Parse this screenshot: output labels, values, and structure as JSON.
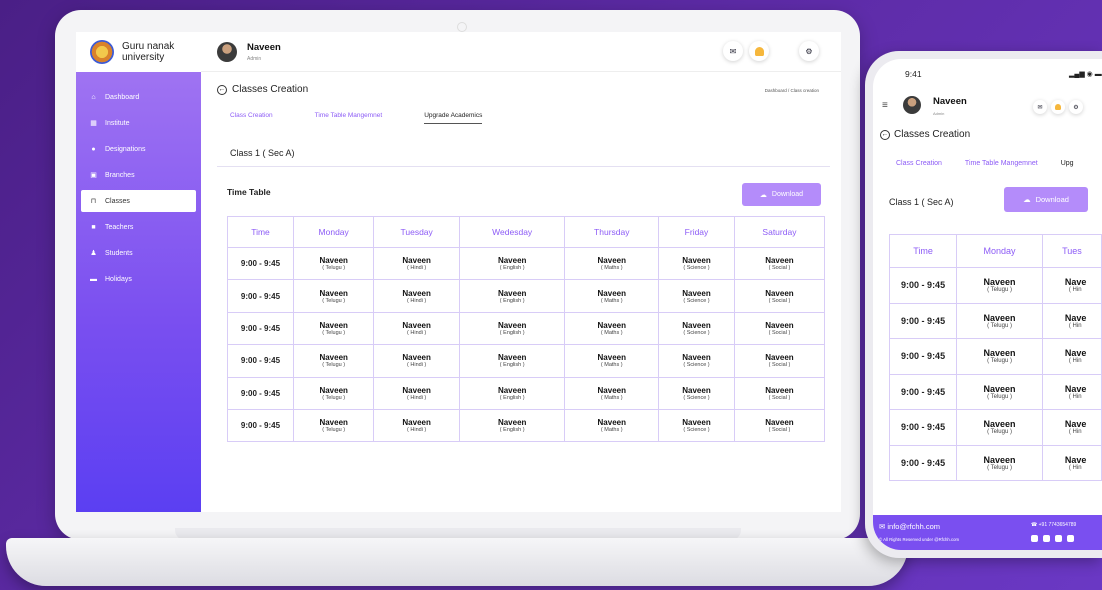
{
  "brand": {
    "name_line1": "Guru nanak",
    "name_line2": "university"
  },
  "sidebar": {
    "items": [
      {
        "label": "Dashboard",
        "icon": "home-icon"
      },
      {
        "label": "Institute",
        "icon": "building-icon"
      },
      {
        "label": "Designations",
        "icon": "users-icon"
      },
      {
        "label": "Branches",
        "icon": "branch-icon"
      },
      {
        "label": "Classes",
        "icon": "classes-icon",
        "active": true
      },
      {
        "label": "Teachers",
        "icon": "teacher-icon"
      },
      {
        "label": "Students",
        "icon": "student-icon"
      },
      {
        "label": "Holidays",
        "icon": "calendar-icon"
      }
    ]
  },
  "header": {
    "user_name": "Naveen",
    "user_role": "Admin"
  },
  "page": {
    "title": "Classes Creation",
    "breadcrumb": "Dashboard /  Class creation",
    "tabs": [
      "Class Creation",
      "Time Table Mangemnet",
      "Upgrade Academics"
    ],
    "active_tab": 2,
    "class_label": "Class 1 ( Sec A)",
    "timetable_label": "Time Table",
    "download_label": "Download"
  },
  "timetable": {
    "headers": [
      "Time",
      "Monday",
      "Tuesday",
      "Wedesday",
      "Thursday",
      "Friday",
      "Saturday"
    ],
    "rows": [
      {
        "time": "9:00 - 9:45",
        "cells": [
          [
            "Naveen",
            "( Telugu )"
          ],
          [
            "Naveen",
            "( Hindi )"
          ],
          [
            "Naveen",
            "( English )"
          ],
          [
            "Naveen",
            "( Maths )"
          ],
          [
            "Naveen",
            "( Science )"
          ],
          [
            "Naveen",
            "( Social )"
          ]
        ]
      },
      {
        "time": "9:00 - 9:45",
        "cells": [
          [
            "Naveen",
            "( Telugu )"
          ],
          [
            "Naveen",
            "( Hindi )"
          ],
          [
            "Naveen",
            "( English )"
          ],
          [
            "Naveen",
            "( Maths )"
          ],
          [
            "Naveen",
            "( Science )"
          ],
          [
            "Naveen",
            "( Social )"
          ]
        ]
      },
      {
        "time": "9:00 - 9:45",
        "cells": [
          [
            "Naveen",
            "( Telugu )"
          ],
          [
            "Naveen",
            "( Hindi )"
          ],
          [
            "Naveen",
            "( English )"
          ],
          [
            "Naveen",
            "( Maths )"
          ],
          [
            "Naveen",
            "( Science )"
          ],
          [
            "Naveen",
            "( Social )"
          ]
        ]
      },
      {
        "time": "9:00 - 9:45",
        "cells": [
          [
            "Naveen",
            "( Telugu )"
          ],
          [
            "Naveen",
            "( Hindi )"
          ],
          [
            "Naveen",
            "( English )"
          ],
          [
            "Naveen",
            "( Maths )"
          ],
          [
            "Naveen",
            "( Science )"
          ],
          [
            "Naveen",
            "( Social )"
          ]
        ]
      },
      {
        "time": "9:00 - 9:45",
        "cells": [
          [
            "Naveen",
            "( Telugu )"
          ],
          [
            "Naveen",
            "( Hindi )"
          ],
          [
            "Naveen",
            "( English )"
          ],
          [
            "Naveen",
            "( Maths )"
          ],
          [
            "Naveen",
            "( Science )"
          ],
          [
            "Naveen",
            "( Social )"
          ]
        ]
      },
      {
        "time": "9:00 - 9:45",
        "cells": [
          [
            "Naveen",
            "( Telugu )"
          ],
          [
            "Naveen",
            "( Hindi )"
          ],
          [
            "Naveen",
            "( English )"
          ],
          [
            "Naveen",
            "( Maths )"
          ],
          [
            "Naveen",
            "( Science )"
          ],
          [
            "Naveen",
            "( Social )"
          ]
        ]
      }
    ]
  },
  "mobile": {
    "clock": "9:41",
    "user_name": "Naveen",
    "user_role": "Admin",
    "title": "Classes Creation",
    "tabs": [
      "Class Creation",
      "Time Table Mangemnet",
      "Upg"
    ],
    "class_label": "Class 1 ( Sec A)",
    "download_label": "Download",
    "headers": [
      "Time",
      "Monday",
      "Tues"
    ],
    "rows": [
      {
        "time": "9:00 - 9:45",
        "c1": [
          "Naveen",
          "( Telugu )"
        ],
        "c2": [
          "Nave",
          "( Hin"
        ]
      },
      {
        "time": "9:00 - 9:45",
        "c1": [
          "Naveen",
          "( Telugu )"
        ],
        "c2": [
          "Nave",
          "( Hin"
        ]
      },
      {
        "time": "9:00 - 9:45",
        "c1": [
          "Naveen",
          "( Telugu )"
        ],
        "c2": [
          "Nave",
          "( Hin"
        ]
      },
      {
        "time": "9:00 - 9:45",
        "c1": [
          "Naveen",
          "( Telugu )"
        ],
        "c2": [
          "Nave",
          "( Hin"
        ]
      },
      {
        "time": "9:00 - 9:45",
        "c1": [
          "Naveen",
          "( Telugu )"
        ],
        "c2": [
          "Nave",
          "( Hin"
        ]
      },
      {
        "time": "9:00 - 9:45",
        "c1": [
          "Naveen",
          "( Telugu )"
        ],
        "c2": [
          "Nave",
          "( Hin"
        ]
      }
    ],
    "footer": {
      "email": "info@rfchh.com",
      "phone": "+91 7743654789",
      "rights": "All Rights Reserved under @Rfchh.com"
    }
  },
  "colors": {
    "accent": "#8d5cf6",
    "sidebar_top": "#a579f3",
    "sidebar_bottom": "#5b3ff2",
    "button": "#b48cfa"
  }
}
